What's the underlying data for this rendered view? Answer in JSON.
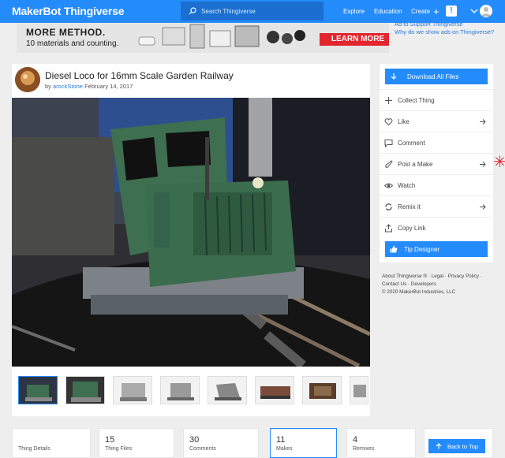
{
  "header": {
    "logo_brand": "MakerBot",
    "logo_product": "Thingiverse",
    "search_placeholder": "Search Thingiverse",
    "nav": {
      "explore": "Explore",
      "education": "Education",
      "create": "Create"
    },
    "notification_glyph": "!"
  },
  "ad": {
    "title": "MORE METHOD.",
    "subtitle": "10 materials and counting.",
    "button": "LEARN MORE",
    "links": [
      "Ad to Support Thingiverse",
      "Why do we show ads on Thingiverse?"
    ]
  },
  "thing": {
    "title": "Diesel Loco for 16mm Scale Garden Railway",
    "by_prefix": "by",
    "author": "arockStone",
    "date": "February 14, 2017",
    "thumbnails_count": 8,
    "selected_thumbnail": 0
  },
  "sidebar": {
    "download_label": "Download All Files",
    "actions": [
      {
        "label": "Collect Thing",
        "icon": "plus-icon",
        "arrow": false
      },
      {
        "label": "Like",
        "icon": "heart-icon",
        "arrow": true
      },
      {
        "label": "Comment",
        "icon": "comment-icon",
        "arrow": false
      },
      {
        "label": "Post a Make",
        "icon": "brush-icon",
        "arrow": true
      },
      {
        "label": "Watch",
        "icon": "eye-icon",
        "arrow": false
      },
      {
        "label": "Remix it",
        "icon": "remix-icon",
        "arrow": true
      },
      {
        "label": "Copy Link",
        "icon": "share-icon",
        "arrow": false
      }
    ],
    "tip_label": "Tip Designer"
  },
  "footer": {
    "line1": [
      "About Thingiverse ®",
      "Legal",
      "Privacy Policy"
    ],
    "line2": [
      "Contact Us",
      "Developers"
    ],
    "copyright": "© 2020 MakerBot Industries, LLC"
  },
  "tabs": [
    {
      "num": "",
      "label": "Thing Details"
    },
    {
      "num": "15",
      "label": "Thing Files"
    },
    {
      "num": "30",
      "label": "Comments"
    },
    {
      "num": "11",
      "label": "Makes"
    },
    {
      "num": "4",
      "label": "Remixes"
    },
    {
      "num": "",
      "label": ""
    }
  ],
  "back_to_top": "Back to Top",
  "colors": {
    "accent": "#248bfb",
    "marker": "#e2232b",
    "ad_button": "#e3262e"
  }
}
